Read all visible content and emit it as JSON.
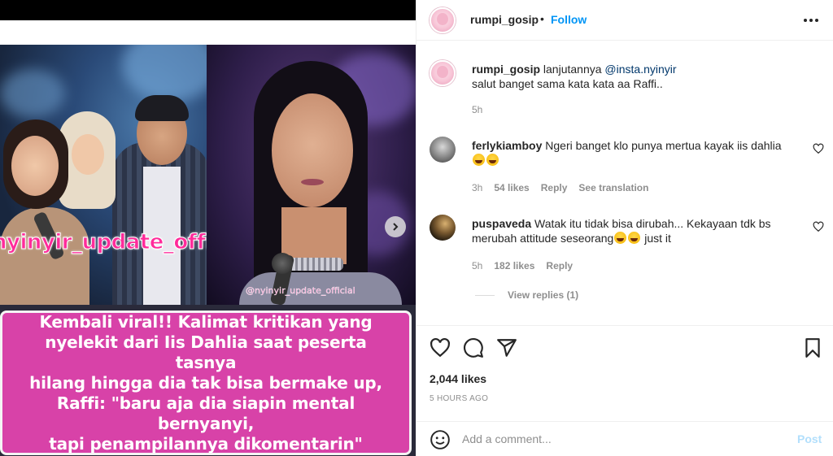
{
  "media": {
    "watermark_left": "nyinyir_update_offi",
    "watermark_right": "@nyinyir_update_official",
    "caption": "Kembali viral!! Kalimat kritikan yang\nnyelekit dari Iis Dahlia saat peserta  tasnya\nhilang  hingga dia tak bisa bermake up,\nRaffi: \"baru aja dia siapin mental bernyanyi,\ntapi penampilannya dikomentarin\"",
    "caption_color": "#d842a8"
  },
  "header": {
    "username": "rumpi_gosip",
    "separator": "•",
    "follow_label": "Follow",
    "more_icon": "more-horizontal-icon"
  },
  "comments": [
    {
      "username": "rumpi_gosip",
      "text_before_mention": " lanjutannya ",
      "mention": "@insta.nyinyir",
      "text_after": "salut banget sama kata kata aa Raffi..",
      "time": "5h"
    },
    {
      "username": "ferlykiamboy",
      "text": " Ngeri banget klo punya mertua kayak iis dahlia",
      "emoji_count": 2,
      "emoji_name": "laughing-face-emoji",
      "time": "3h",
      "likes": "54 likes",
      "reply": "Reply",
      "translation": "See translation"
    },
    {
      "username": "puspaveda",
      "text": " Watak itu tidak bisa dirubah... Kekayaan tdk bs merubah attitude seseorang",
      "text_tail": " just it",
      "emoji_count": 2,
      "emoji_name": "laughing-face-emoji",
      "time": "5h",
      "likes": "182 likes",
      "reply": "Reply",
      "view_replies": "View replies (1)"
    }
  ],
  "actions": {
    "like_icon": "heart-icon",
    "comment_icon": "comment-icon",
    "share_icon": "share-icon",
    "save_icon": "bookmark-icon",
    "likes_count": "2,044 likes",
    "posted_ago": "5 HOURS AGO"
  },
  "add_comment": {
    "placeholder": "Add a comment...",
    "post_label": "Post",
    "emoji_icon": "smiley-icon"
  },
  "colors": {
    "accent": "#0095f6",
    "mention": "#00376b",
    "muted": "#8e8e8e",
    "post_disabled": "#b2dffc"
  }
}
